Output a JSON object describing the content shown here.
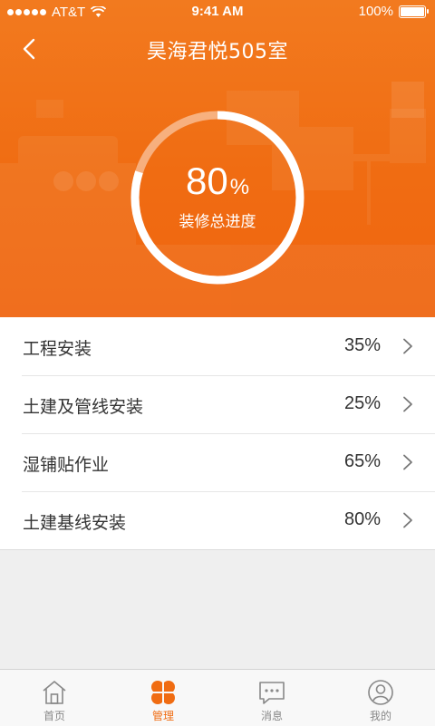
{
  "status_bar": {
    "carrier": "AT&T",
    "time": "9:41 AM",
    "battery": "100%"
  },
  "header": {
    "title": "昊海君悦505室"
  },
  "progress": {
    "value": "80",
    "unit": "%",
    "label": "装修总进度",
    "fraction": 0.8
  },
  "items": [
    {
      "name": "工程安装",
      "percent": "35%"
    },
    {
      "name": "土建及管线安装",
      "percent": "25%"
    },
    {
      "name": "湿铺贴作业",
      "percent": "65%"
    },
    {
      "name": "土建基线安装",
      "percent": "80%"
    }
  ],
  "tabs": [
    {
      "label": "首页",
      "icon": "home-icon",
      "active": false
    },
    {
      "label": "管理",
      "icon": "clover-icon",
      "active": true
    },
    {
      "label": "消息",
      "icon": "chat-icon",
      "active": false
    },
    {
      "label": "我的",
      "icon": "user-icon",
      "active": false
    }
  ],
  "colors": {
    "accent": "#f06c12",
    "tab_inactive": "#888888",
    "text": "#333333"
  }
}
